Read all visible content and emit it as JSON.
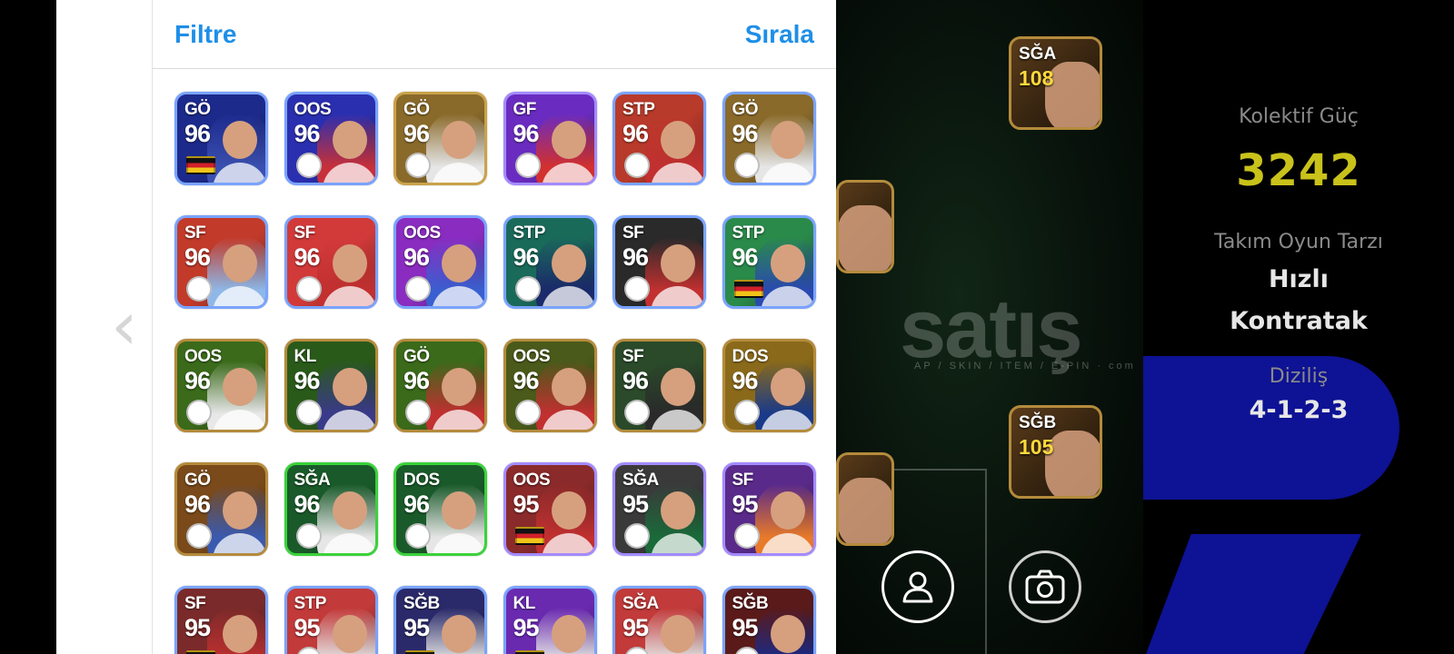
{
  "header": {
    "filter_label": "Filtre",
    "sort_label": "Sırala"
  },
  "cards": [
    {
      "pos": "GÖ",
      "rating": "96",
      "bg": "#1c2a8c",
      "border": "#7aa3ff",
      "face": "#3a4fb0",
      "badge": "flag"
    },
    {
      "pos": "OOS",
      "rating": "96",
      "bg": "#2a2fb0",
      "border": "#7aa3ff",
      "face": "#c7303a",
      "badge": "round"
    },
    {
      "pos": "GÖ",
      "rating": "96",
      "bg": "#8a6a2a",
      "border": "#c9a24a",
      "face": "#e6e6e6",
      "badge": "round"
    },
    {
      "pos": "GF",
      "rating": "96",
      "bg": "#6a2cc0",
      "border": "#a38bff",
      "face": "#d33030",
      "badge": "round"
    },
    {
      "pos": "STP",
      "rating": "96",
      "bg": "#b83a2a",
      "border": "#7aa3ff",
      "face": "#c23030",
      "badge": "round"
    },
    {
      "pos": "GÖ",
      "rating": "96",
      "bg": "#8a6a2a",
      "border": "#7aa3ff",
      "face": "#e6e6e6",
      "badge": "round"
    },
    {
      "pos": "SF",
      "rating": "96",
      "bg": "#c23a2a",
      "border": "#7aa3ff",
      "face": "#8fb8e8",
      "badge": "round"
    },
    {
      "pos": "SF",
      "rating": "96",
      "bg": "#d23a3a",
      "border": "#7aa3ff",
      "face": "#c23030",
      "badge": "round"
    },
    {
      "pos": "OOS",
      "rating": "96",
      "bg": "#8a2cc0",
      "border": "#7aa3ff",
      "face": "#3a5fd0",
      "badge": "round"
    },
    {
      "pos": "STP",
      "rating": "96",
      "bg": "#1a6a5a",
      "border": "#7aa3ff",
      "face": "#1a2a6a",
      "badge": "round"
    },
    {
      "pos": "SF",
      "rating": "96",
      "bg": "#2a2a2a",
      "border": "#7aa3ff",
      "face": "#c23030",
      "badge": "round"
    },
    {
      "pos": "STP",
      "rating": "96",
      "bg": "#2a8a4a",
      "border": "#7aa3ff",
      "face": "#2a4ab0",
      "badge": "flag"
    },
    {
      "pos": "OOS",
      "rating": "96",
      "bg": "#3a6a1a",
      "border": "#b48b3c",
      "face": "#e8e8e8",
      "badge": "round"
    },
    {
      "pos": "KL",
      "rating": "96",
      "bg": "#2a5a1a",
      "border": "#b48b3c",
      "face": "#3a3a8a",
      "badge": "round"
    },
    {
      "pos": "GÖ",
      "rating": "96",
      "bg": "#3a6a1a",
      "border": "#b48b3c",
      "face": "#c23030",
      "badge": "round"
    },
    {
      "pos": "OOS",
      "rating": "96",
      "bg": "#4a5a1a",
      "border": "#b48b3c",
      "face": "#c23030",
      "badge": "round"
    },
    {
      "pos": "SF",
      "rating": "96",
      "bg": "#2a4a2a",
      "border": "#b48b3c",
      "face": "#2a2a2a",
      "badge": "round"
    },
    {
      "pos": "DOS",
      "rating": "96",
      "bg": "#8a6a1a",
      "border": "#b48b3c",
      "face": "#1a3a8a",
      "badge": "round"
    },
    {
      "pos": "GÖ",
      "rating": "96",
      "bg": "#7a4a1a",
      "border": "#b48b3c",
      "face": "#3a5ab0",
      "badge": "round"
    },
    {
      "pos": "SĞA",
      "rating": "96",
      "bg": "#1a5a2a",
      "border": "#3ad23a",
      "face": "#e6e6e6",
      "badge": "round"
    },
    {
      "pos": "DOS",
      "rating": "96",
      "bg": "#1a5a2a",
      "border": "#3ad23a",
      "face": "#e6e6e6",
      "badge": "round"
    },
    {
      "pos": "OOS",
      "rating": "95",
      "bg": "#8a2a2a",
      "border": "#a38bff",
      "face": "#c23030",
      "badge": "flag"
    },
    {
      "pos": "SĞA",
      "rating": "95",
      "bg": "#3a3a3a",
      "border": "#a38bff",
      "face": "#1a6a3a",
      "badge": "round"
    },
    {
      "pos": "SF",
      "rating": "95",
      "bg": "#5a2a8a",
      "border": "#a38bff",
      "face": "#e87a2a",
      "badge": "round"
    },
    {
      "pos": "SF",
      "rating": "95",
      "bg": "#7a2a2a",
      "border": "#7aa3ff",
      "face": "#c23030",
      "badge": "flag"
    },
    {
      "pos": "STP",
      "rating": "95",
      "bg": "#c23a3a",
      "border": "#7aa3ff",
      "face": "#e6e6e6",
      "badge": "round"
    },
    {
      "pos": "SĞB",
      "rating": "95",
      "bg": "#2a2a6a",
      "border": "#7aa3ff",
      "face": "#e6e6e6",
      "badge": "flag"
    },
    {
      "pos": "KL",
      "rating": "95",
      "bg": "#6a2ab0",
      "border": "#7aa3ff",
      "face": "#e6e6e6",
      "badge": "flag"
    },
    {
      "pos": "SĞA",
      "rating": "95",
      "bg": "#c23a3a",
      "border": "#7aa3ff",
      "face": "#e6e6e6",
      "badge": "round"
    },
    {
      "pos": "SĞB",
      "rating": "95",
      "bg": "#5a1a1a",
      "border": "#7aa3ff",
      "face": "#1a2a8a",
      "badge": "round"
    }
  ],
  "pitch": {
    "watermark": "satış",
    "watermark_sub": "AP / SKIN / ITEM / E-PIN · com",
    "cards": [
      {
        "pos": "SĞA",
        "rating": "108"
      },
      {
        "pos": "SĞB",
        "rating": "105"
      }
    ]
  },
  "stats": {
    "power_label": "Kolektif Güç",
    "power_value": "3242",
    "style_label": "Takım Oyun Tarzı",
    "style_line1": "Hızlı",
    "style_line2": "Kontratak",
    "formation_label": "Diziliş",
    "formation_value": "4-1-2-3"
  },
  "colors": {
    "accent_blue": "#1e8fe8",
    "power_yellow": "#c9c21b",
    "panel_blue": "#0e1294"
  }
}
